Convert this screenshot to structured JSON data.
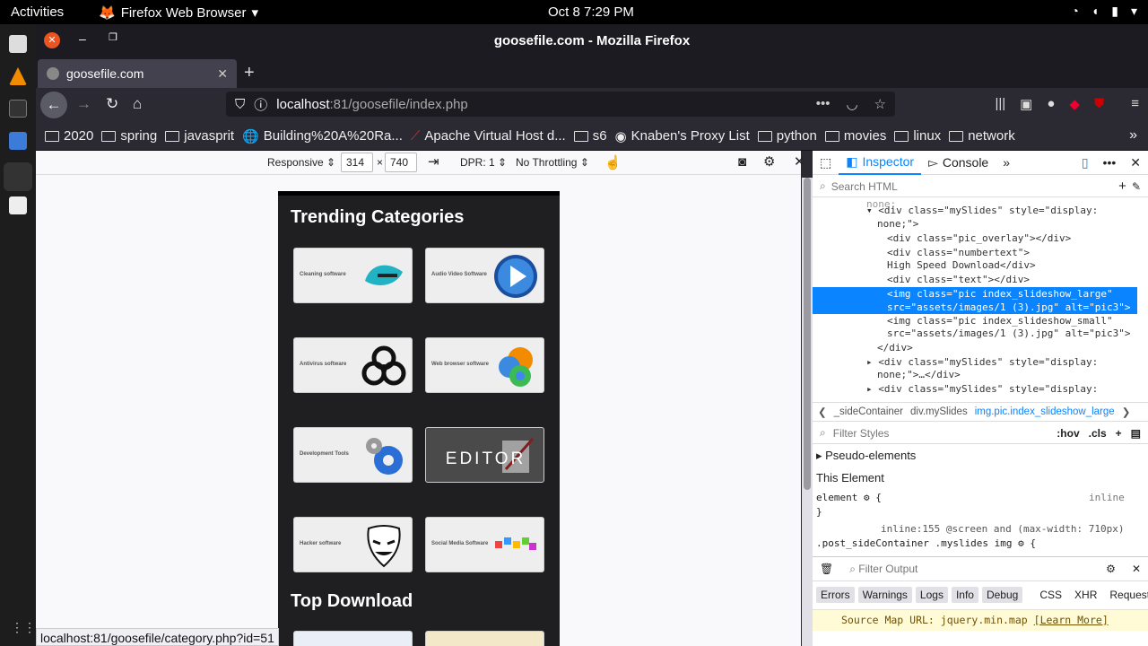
{
  "system": {
    "activities": "Activities",
    "app_name": "Firefox Web Browser",
    "clock": "Oct 8  7:29 PM"
  },
  "window": {
    "title": "goosefile.com - Mozilla Firefox"
  },
  "tab": {
    "title": "goosefile.com"
  },
  "url": {
    "host": "localhost",
    "port": ":81",
    "path": "/goosefile/index.php"
  },
  "bookmarks": [
    "2020",
    "spring",
    "javasprit",
    "Building%20A%20Ra...",
    "Apache Virtual Host d...",
    "s6",
    "Knaben's Proxy List",
    "python",
    "movies",
    "linux",
    "network"
  ],
  "rdm": {
    "device": "Responsive",
    "width": "314",
    "times": "×",
    "height": "740",
    "dpr": "DPR: 1",
    "throttle": "No Throttling"
  },
  "page": {
    "section1": "Trending Categories",
    "section2": "Top Download",
    "cards": [
      {
        "label": "Cleaning software",
        "icon": "cleaner-splash-icon"
      },
      {
        "label": "Audio Video Software",
        "icon": "play-icon"
      },
      {
        "label": "Antivirus software",
        "icon": "biohazard-icon"
      },
      {
        "label": "Web browser software",
        "icon": "browser-icon"
      },
      {
        "label": "Development Tools",
        "icon": "gears-icon"
      },
      {
        "label": "EDITOR",
        "icon": "editor-icon"
      },
      {
        "label": "Hacker software",
        "icon": "mask-icon"
      },
      {
        "label": "Social Media Software",
        "icon": "social-icon"
      }
    ]
  },
  "status_url": "localhost:81/goosefile/category.php?id=51",
  "devtools": {
    "inspector": "Inspector",
    "console": "Console",
    "search_placeholder": "Search HTML",
    "tree": [
      "<div class=\"mySlides\" style=\"display:",
      "none;\">",
      "<div class=\"pic_overlay\"></div>",
      "<div class=\"numbertext\">",
      "High Speed Download</div>",
      "<div class=\"text\"></div>",
      "<img class=\"pic index_slideshow_large\"",
      "src=\"assets/images/1 (3).jpg\" alt=\"pic3\">",
      "<img class=\"pic index_slideshow_small\"",
      "src=\"assets/images/1 (3).jpg\" alt=\"pic3\">",
      "</div>",
      "<div class=\"mySlides\" style=\"display:",
      "none;\">…</div>",
      "<div class=\"mySlides\" style=\"display:"
    ],
    "crumbs": [
      "_sideContainer",
      "div.mySlides",
      "img.pic.index_slideshow_large"
    ],
    "filter_styles": "Filter Styles",
    "hov": ":hov",
    "cls": ".cls",
    "pseudo": "Pseudo-elements",
    "this_element": "This Element",
    "rule1": "element",
    "rule1_brace": "{",
    "rule1_close": "}",
    "inline": "inline",
    "rule2_src": "inline:155 @screen and (max-width: 710px)",
    "rule2_sel": ".post_sideContainer .myslides img",
    "filter_output": "Filter Output",
    "cfilters": [
      "Errors",
      "Warnings",
      "Logs",
      "Info",
      "Debug"
    ],
    "cplain": [
      "CSS",
      "XHR",
      "Requests"
    ],
    "msg": "Source Map URL: jquery.min.map",
    "msg_link": "[Learn More]"
  }
}
